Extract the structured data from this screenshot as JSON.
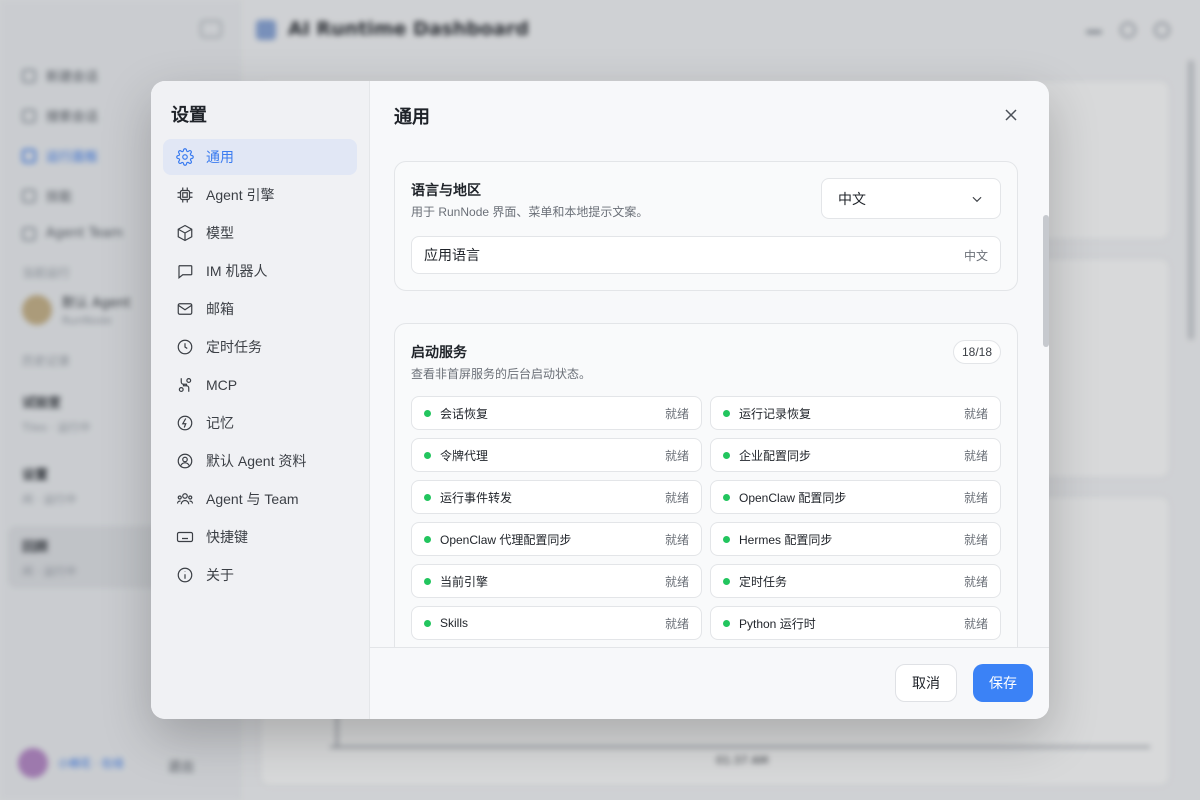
{
  "background": {
    "title": "AI Runtime Dashboard",
    "nav": [
      "新建会话",
      "搜索会话",
      "运行面板",
      "技能",
      "Agent Team"
    ],
    "section_label": "当前运行",
    "agent_name": "默认 Agent",
    "agent_sub": "RunNode",
    "records_label": "历史记录",
    "records": [
      {
        "title": "试验室",
        "sub": "Tiles · 运行中"
      },
      {
        "title": "设置",
        "sub": "闲 · 运行中"
      },
      {
        "title": "回顾",
        "sub": "闲 · 运行中"
      }
    ],
    "user_sub": "小棉花 · 在线",
    "logout": "退出",
    "axis_label": "01:37 AM"
  },
  "modal": {
    "title": "设置",
    "nav": [
      {
        "label": "通用",
        "icon": "gear-icon",
        "active": true
      },
      {
        "label": "Agent 引擎",
        "icon": "chip-icon",
        "active": false
      },
      {
        "label": "模型",
        "icon": "cube-icon",
        "active": false
      },
      {
        "label": "IM 机器人",
        "icon": "chat-icon",
        "active": false
      },
      {
        "label": "邮箱",
        "icon": "mail-icon",
        "active": false
      },
      {
        "label": "定时任务",
        "icon": "clock-icon",
        "active": false
      },
      {
        "label": "MCP",
        "icon": "plug-icon",
        "active": false
      },
      {
        "label": "记忆",
        "icon": "bolt-icon",
        "active": false
      },
      {
        "label": "默认 Agent 资料",
        "icon": "user-circle-icon",
        "active": false
      },
      {
        "label": "Agent 与 Team",
        "icon": "team-icon",
        "active": false
      },
      {
        "label": "快捷键",
        "icon": "keyboard-icon",
        "active": false
      },
      {
        "label": "关于",
        "icon": "info-icon",
        "active": false
      }
    ],
    "content_title": "通用",
    "language": {
      "title": "语言与地区",
      "desc": "用于 RunNode 界面、菜单和本地提示文案。",
      "select_value": "中文",
      "app_language_label": "应用语言",
      "app_language_value": "中文"
    },
    "services": {
      "title": "启动服务",
      "desc": "查看非首屏服务的后台启动状态。",
      "count": "18/18",
      "items": [
        {
          "name": "会话恢复",
          "status": "就绪"
        },
        {
          "name": "运行记录恢复",
          "status": "就绪"
        },
        {
          "name": "令牌代理",
          "status": "就绪"
        },
        {
          "name": "企业配置同步",
          "status": "就绪"
        },
        {
          "name": "运行事件转发",
          "status": "就绪"
        },
        {
          "name": "OpenClaw 配置同步",
          "status": "就绪"
        },
        {
          "name": "OpenClaw 代理配置同步",
          "status": "就绪"
        },
        {
          "name": "Hermes 配置同步",
          "status": "就绪"
        },
        {
          "name": "当前引擎",
          "status": "就绪"
        },
        {
          "name": "定时任务",
          "status": "就绪"
        },
        {
          "name": "Skills",
          "status": "就绪"
        },
        {
          "name": "Python 运行时",
          "status": "就绪"
        }
      ]
    },
    "cancel_label": "取消",
    "save_label": "保存"
  },
  "colors": {
    "accent": "#3b82f6",
    "active_nav_bg": "#e1e7f5",
    "status_ok": "#22c55e"
  }
}
